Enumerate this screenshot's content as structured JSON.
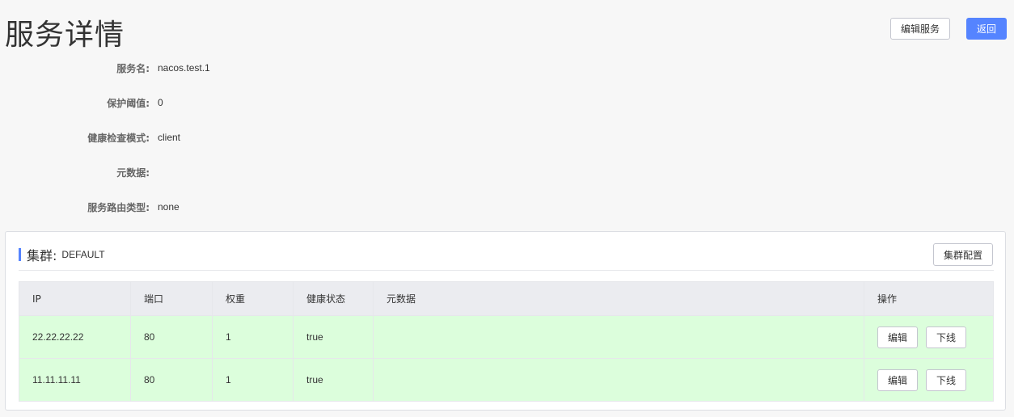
{
  "header": {
    "title": "服务详情",
    "edit_service_label": "编辑服务",
    "back_label": "返回"
  },
  "service_info": {
    "name_label": "服务名:",
    "name_value": "nacos.test.1",
    "threshold_label": "保护阈值:",
    "threshold_value": "0",
    "health_mode_label": "健康检查模式:",
    "health_mode_value": "client",
    "metadata_label": "元数据:",
    "metadata_value": "",
    "route_type_label": "服务路由类型:",
    "route_type_value": "none"
  },
  "cluster": {
    "label": "集群:",
    "name": "DEFAULT",
    "config_button_label": "集群配置"
  },
  "table": {
    "columns": [
      "IP",
      "端口",
      "权重",
      "健康状态",
      "元数据",
      "操作"
    ],
    "rows": [
      {
        "ip": "22.22.22.22",
        "port": "80",
        "weight": "1",
        "healthy": "true",
        "metadata": "",
        "edit_label": "编辑",
        "offline_label": "下线"
      },
      {
        "ip": "11.11.11.11",
        "port": "80",
        "weight": "1",
        "healthy": "true",
        "metadata": "",
        "edit_label": "编辑",
        "offline_label": "下线"
      }
    ]
  },
  "colors": {
    "primary": "#5584ff",
    "healthy_row_bg": "#dcfedc",
    "header_bg": "#ebecf0",
    "page_bg": "#f7f7f7"
  }
}
